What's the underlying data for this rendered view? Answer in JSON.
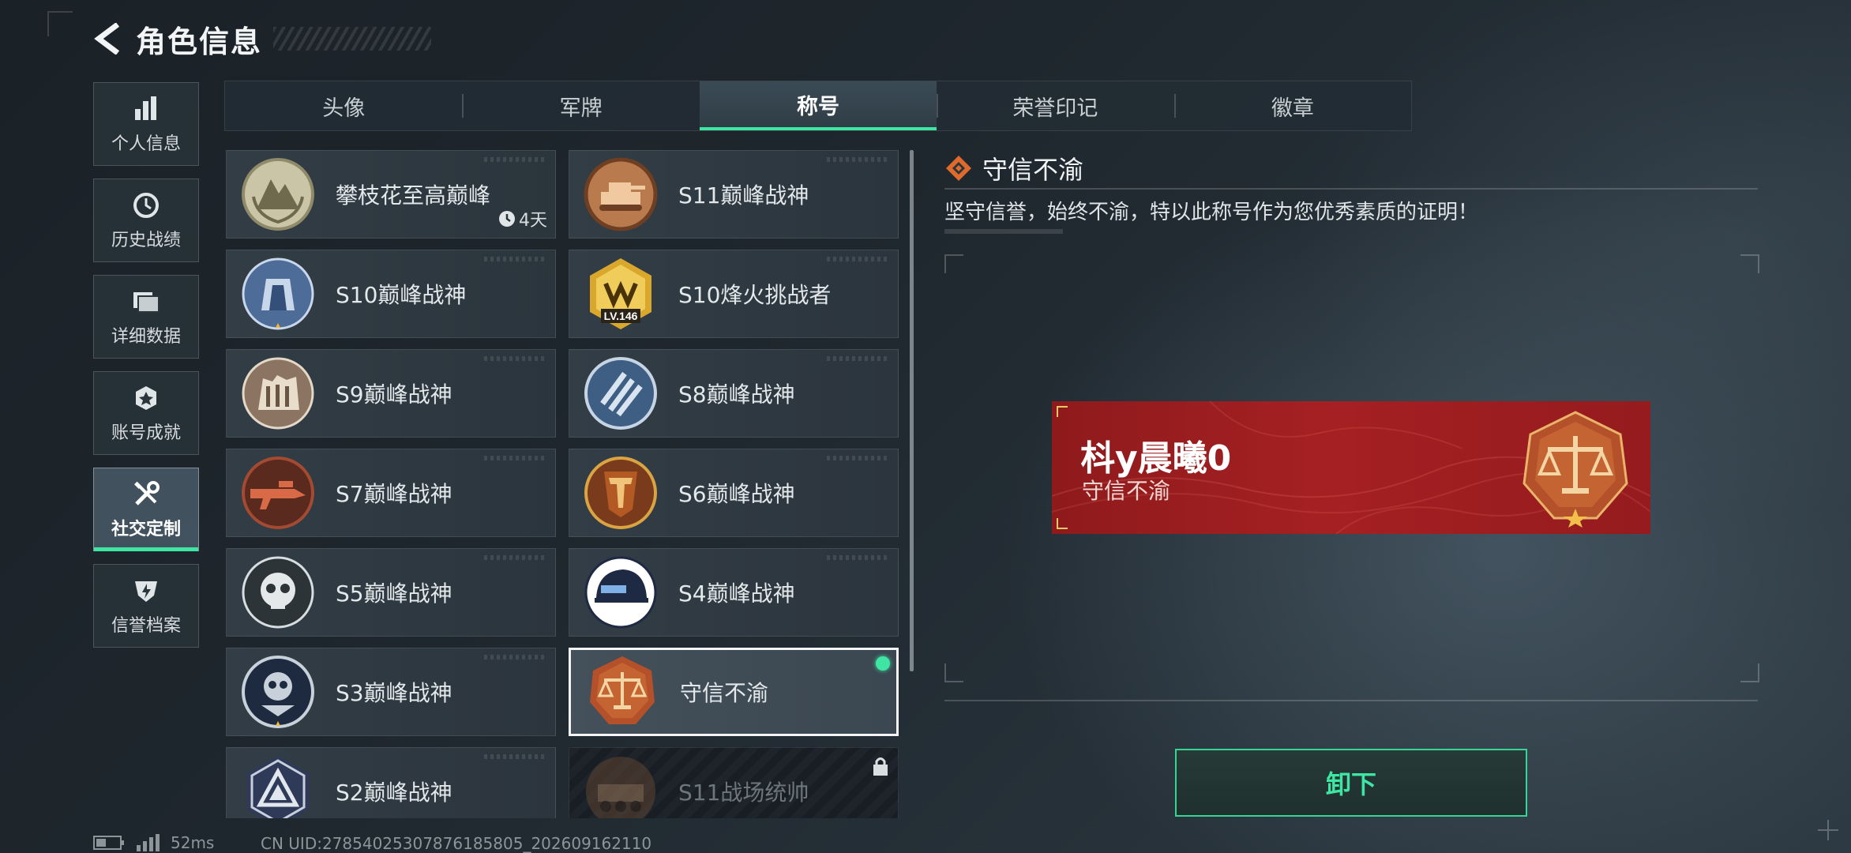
{
  "header": {
    "title": "角色信息"
  },
  "sidebar": {
    "items": [
      {
        "label": "个人信息",
        "icon": "bar-chart-icon"
      },
      {
        "label": "历史战绩",
        "icon": "clock-icon"
      },
      {
        "label": "详细数据",
        "icon": "folder-icon"
      },
      {
        "label": "账号成就",
        "icon": "achievement-icon"
      },
      {
        "label": "社交定制",
        "icon": "tools-icon",
        "active": true
      },
      {
        "label": "信誉档案",
        "icon": "shield-icon"
      }
    ]
  },
  "tabs": [
    {
      "label": "头像"
    },
    {
      "label": "军牌"
    },
    {
      "label": "称号",
      "active": true
    },
    {
      "label": "荣誉印记"
    },
    {
      "label": "徽章"
    }
  ],
  "titles": [
    {
      "name": "攀枝花至高巅峰",
      "medal": "laurel-mountain-medal",
      "timer": "4天"
    },
    {
      "name": "S11巅峰战神",
      "medal": "tank-medal"
    },
    {
      "name": "S10巅峰战神",
      "medal": "blue-fortress-medal"
    },
    {
      "name": "S10烽火挑战者",
      "medal": "gold-crown-medal",
      "level": "LV.146"
    },
    {
      "name": "S9巅峰战神",
      "medal": "ruins-medal"
    },
    {
      "name": "S8巅峰战神",
      "medal": "blue-stripes-medal"
    },
    {
      "name": "S7巅峰战神",
      "medal": "rifle-medal"
    },
    {
      "name": "S6巅峰战神",
      "medal": "gold-t-medal"
    },
    {
      "name": "S5巅峰战神",
      "medal": "skull-medal"
    },
    {
      "name": "S4巅峰战神",
      "medal": "helmet-medal"
    },
    {
      "name": "S3巅峰战神",
      "medal": "silver-skull-medal"
    },
    {
      "name": "守信不渝",
      "medal": "scales-medal",
      "selected": true,
      "equipped": true
    },
    {
      "name": "S2巅峰战神",
      "medal": "triangle-medal"
    },
    {
      "name": "S11战场统帅",
      "medal": "armored-vehicle-medal",
      "locked": true
    }
  ],
  "detail": {
    "title": "守信不渝",
    "description": "坚守信誉，始终不渝，特以此称号作为您优秀素质的证明！"
  },
  "banner": {
    "player_name": "枓y晨曦0",
    "title": "守信不渝",
    "medal": "scales-medal",
    "color": "#a52022"
  },
  "actions": {
    "unequip_label": "卸下"
  },
  "status": {
    "ping": "52ms",
    "uid": "CN UID:2785402530787618580​5_202609162110"
  },
  "colors": {
    "accent": "#3fe6a3",
    "banner_red": "#a52022"
  }
}
